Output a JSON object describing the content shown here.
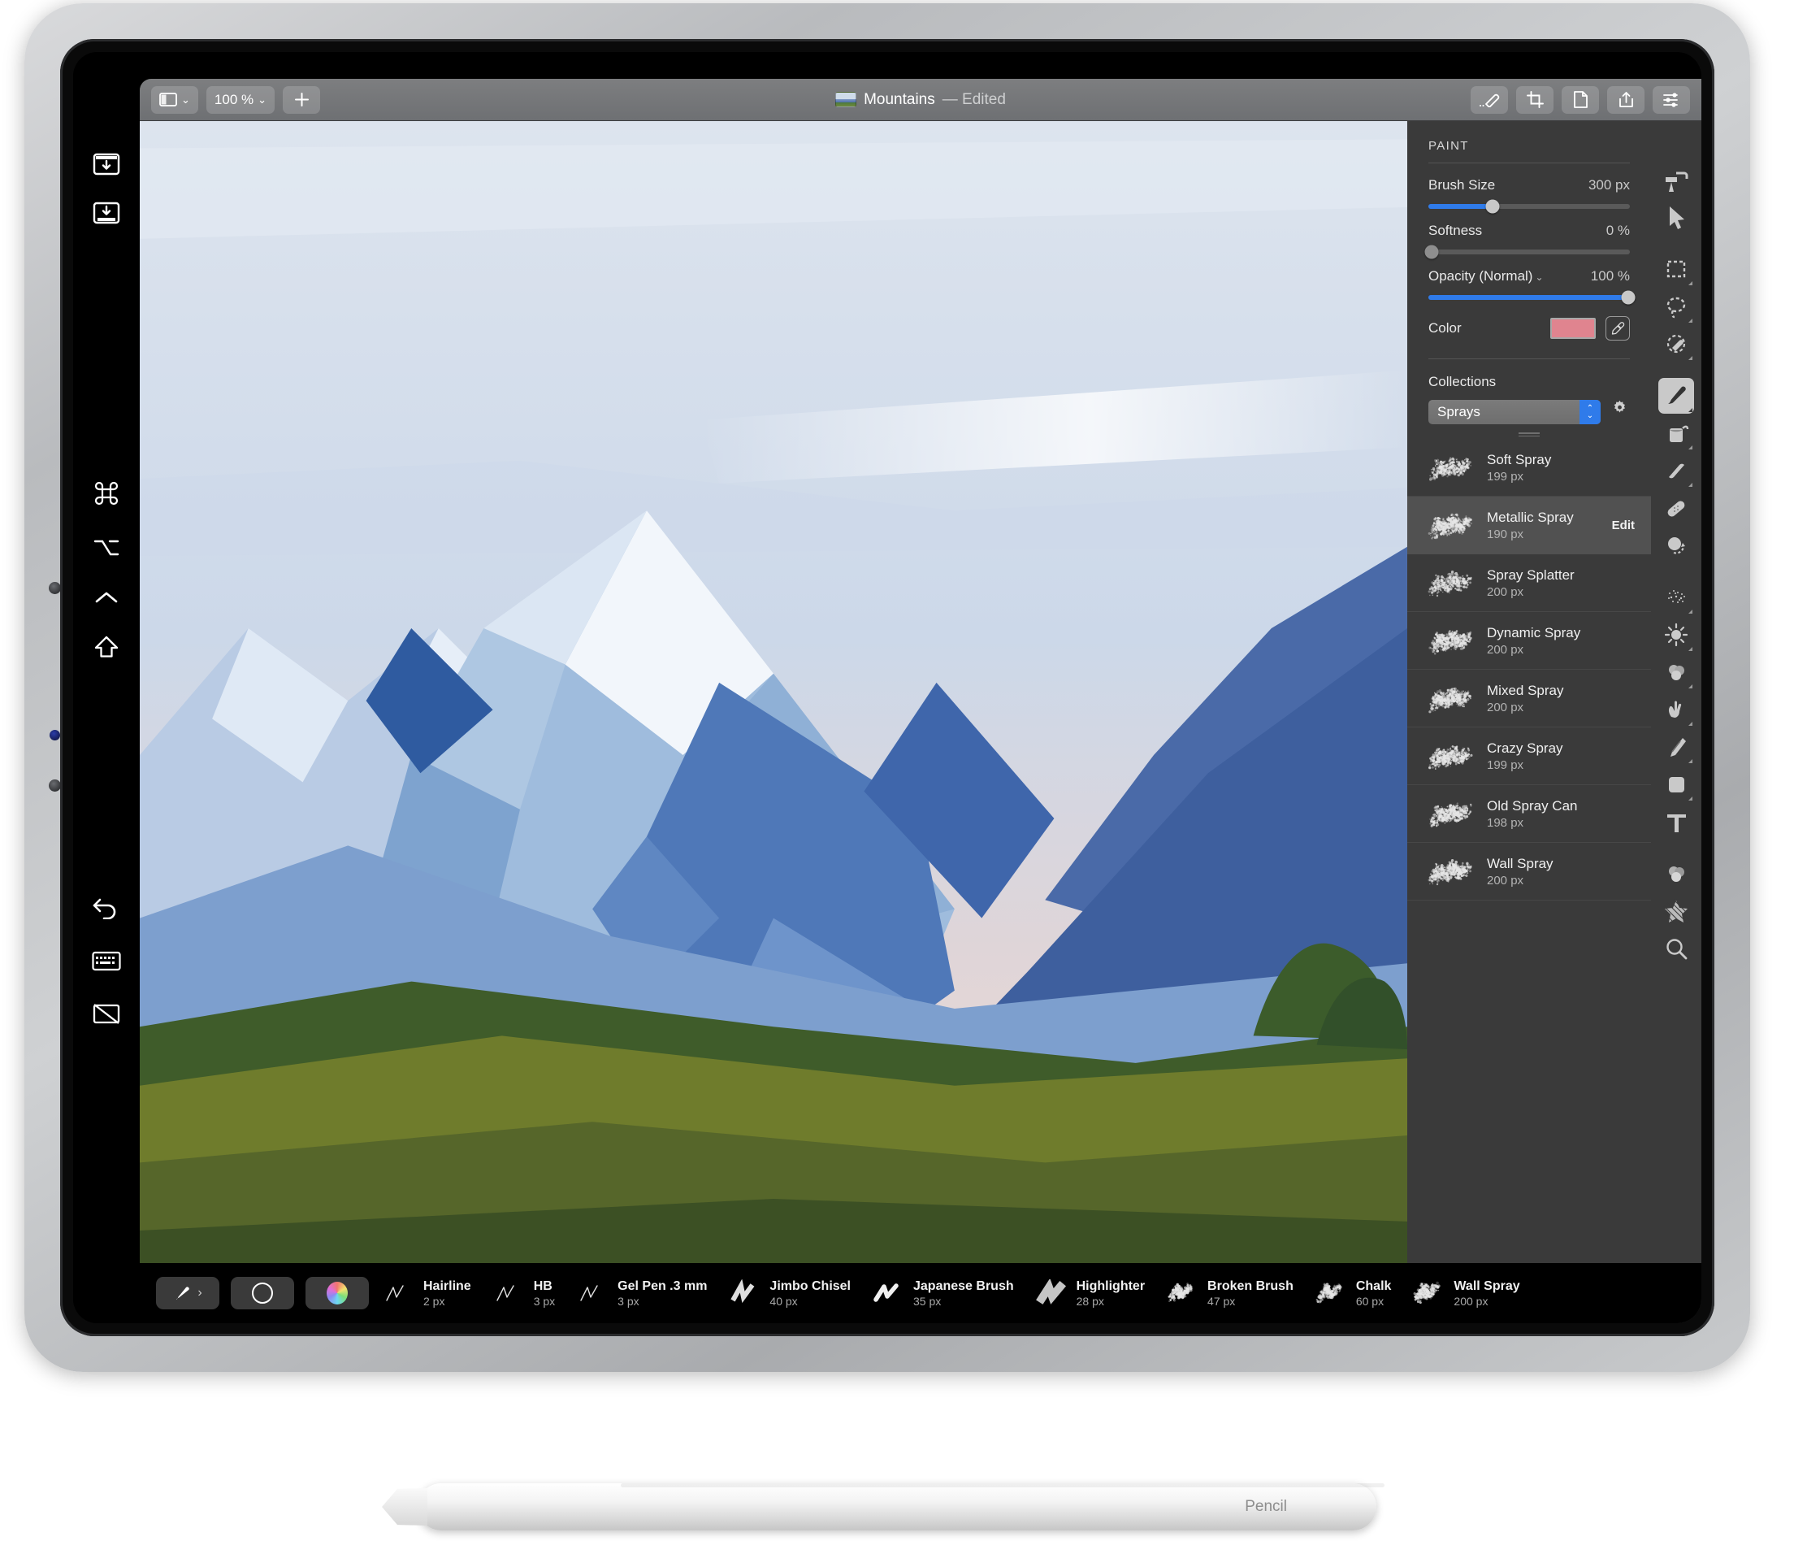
{
  "app": {
    "title": "Mountains",
    "title_suffix": "— Edited",
    "zoom_level": "100 %"
  },
  "toolbar": {
    "left_buttons": [
      {
        "name": "sidebar-toggle",
        "icon": "panel-icon",
        "label": ""
      },
      {
        "name": "zoom-select",
        "icon": "chevron-down-icon",
        "label": "100 %"
      },
      {
        "name": "new-layer",
        "icon": "plus-icon",
        "label": "+"
      }
    ],
    "right_buttons": [
      {
        "name": "markup",
        "icon": "pen-markup-icon"
      },
      {
        "name": "crop",
        "icon": "crop-icon"
      },
      {
        "name": "document",
        "icon": "document-icon"
      },
      {
        "name": "share",
        "icon": "share-icon"
      },
      {
        "name": "adjustments",
        "icon": "sliders-icon"
      }
    ]
  },
  "left_rail": {
    "items": [
      {
        "name": "import-top",
        "icon": "window-download-icon"
      },
      {
        "name": "export-bottom",
        "icon": "dock-download-icon"
      },
      {
        "name": "command-key",
        "icon": "command-icon"
      },
      {
        "name": "option-key",
        "icon": "option-icon"
      },
      {
        "name": "control-key",
        "icon": "control-icon"
      },
      {
        "name": "shift-key",
        "icon": "shift-icon"
      },
      {
        "name": "undo",
        "icon": "undo-icon"
      },
      {
        "name": "keyboard",
        "icon": "keyboard-icon"
      },
      {
        "name": "hide-ui",
        "icon": "screen-off-icon"
      }
    ]
  },
  "paint_panel": {
    "header": "PAINT",
    "brush_size": {
      "label": "Brush Size",
      "value": "300 px",
      "fill_pct": 32
    },
    "softness": {
      "label": "Softness",
      "value": "0 %",
      "fill_pct": 0
    },
    "opacity": {
      "label": "Opacity (Normal)",
      "value": "100 %",
      "fill_pct": 100,
      "caret": "⌄"
    },
    "color": {
      "label": "Color",
      "swatch_hex": "#e0848f"
    },
    "collections": {
      "label": "Collections",
      "selected": "Sprays"
    },
    "brushes": [
      {
        "name": "Soft Spray",
        "size": "199 px",
        "selected": false
      },
      {
        "name": "Metallic Spray",
        "size": "190 px",
        "selected": true,
        "edit_label": "Edit"
      },
      {
        "name": "Spray Splatter",
        "size": "200 px",
        "selected": false
      },
      {
        "name": "Dynamic Spray",
        "size": "200 px",
        "selected": false
      },
      {
        "name": "Mixed Spray",
        "size": "200 px",
        "selected": false
      },
      {
        "name": "Crazy Spray",
        "size": "199 px",
        "selected": false
      },
      {
        "name": "Old Spray Can",
        "size": "198 px",
        "selected": false
      },
      {
        "name": "Wall Spray",
        "size": "200 px",
        "selected": false
      }
    ]
  },
  "tool_rail": {
    "tools": [
      {
        "name": "paint-roller-icon",
        "active": false,
        "submenu": false
      },
      {
        "name": "pointer-icon",
        "active": false,
        "submenu": false
      },
      {
        "name": "rect-select-icon",
        "active": false,
        "submenu": true
      },
      {
        "name": "lasso-select-icon",
        "active": false,
        "submenu": true
      },
      {
        "name": "magic-wand-select-icon",
        "active": false,
        "submenu": true
      },
      {
        "name": "paintbrush-icon",
        "active": true,
        "submenu": true
      },
      {
        "name": "paint-bucket-icon",
        "active": false,
        "submenu": true
      },
      {
        "name": "eraser-icon",
        "active": false,
        "submenu": true
      },
      {
        "name": "bandage-retouch-icon",
        "active": false,
        "submenu": false
      },
      {
        "name": "clone-stamp-icon",
        "active": false,
        "submenu": false
      },
      {
        "name": "noise-icon",
        "active": false,
        "submenu": true
      },
      {
        "name": "dodge-burn-icon",
        "active": false,
        "submenu": true
      },
      {
        "name": "blur-smudge-icon",
        "active": false,
        "submenu": true
      },
      {
        "name": "pinch-liquify-icon",
        "active": false,
        "submenu": true
      },
      {
        "name": "pen-path-icon",
        "active": false,
        "submenu": true
      },
      {
        "name": "shape-icon",
        "active": false,
        "submenu": true
      },
      {
        "name": "text-icon",
        "active": false,
        "submenu": false
      },
      {
        "name": "color-mix-icon",
        "active": false,
        "submenu": false
      },
      {
        "name": "gradient-hatch-icon",
        "active": false,
        "submenu": false
      },
      {
        "name": "zoom-magnifier-icon",
        "active": false,
        "submenu": false
      }
    ]
  },
  "bottom_bar": {
    "buttons": [
      {
        "name": "brush-picker",
        "icon": "paintbrush-icon"
      },
      {
        "name": "brush-shape",
        "icon": "circle-icon"
      },
      {
        "name": "color-wheel",
        "icon": "color-wheel-icon"
      }
    ],
    "brushes": [
      {
        "name": "Hairline",
        "size": "2 px",
        "style": "thin"
      },
      {
        "name": "HB",
        "size": "3 px",
        "style": "thin"
      },
      {
        "name": "Gel Pen .3 mm",
        "size": "3 px",
        "style": "thin"
      },
      {
        "name": "Jimbo Chisel",
        "size": "40 px",
        "style": "chisel"
      },
      {
        "name": "Japanese Brush",
        "size": "35 px",
        "style": "brush"
      },
      {
        "name": "Highlighter",
        "size": "28 px",
        "style": "marker"
      },
      {
        "name": "Broken Brush",
        "size": "47 px",
        "style": "rough"
      },
      {
        "name": "Chalk",
        "size": "60 px",
        "style": "chalk"
      },
      {
        "name": "Wall Spray",
        "size": "200 px",
        "style": "spray"
      }
    ]
  },
  "pencil": {
    "label": "Pencil",
    "logo": "apple-logo-icon"
  },
  "colors": {
    "accent_blue": "#2f7bea",
    "panel_bg": "#3a3a3a",
    "titlebar": "#6e7073",
    "brush_swatch": "#e0848f"
  }
}
